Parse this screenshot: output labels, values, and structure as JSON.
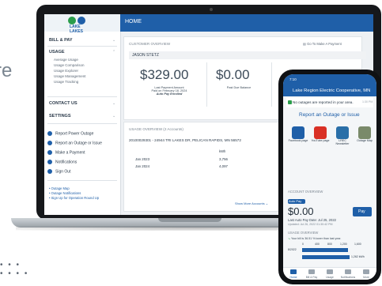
{
  "side_text": "re",
  "laptop": {
    "sidebar": {
      "logo_text": "LAKE LAKES",
      "sections": [
        {
          "label": "BILL & PAY"
        },
        {
          "label": "USAGE",
          "items": [
            "Average Usage",
            "Usage Comparison",
            "Usage Explorer",
            "Usage Management",
            "Usage Tracking"
          ]
        },
        {
          "label": "CONTACT US"
        },
        {
          "label": "SETTINGS"
        }
      ],
      "actions": [
        "Report Power Outage",
        "Report an Outage or Issue",
        "Make a Payment",
        "Notifications",
        "Sign Out"
      ],
      "links": [
        "Outage Map",
        "Outage Notifications",
        "Sign Up for Operation Round Up"
      ]
    },
    "header": {
      "title": "HOME"
    },
    "overview": {
      "title": "CUSTOMER OVERVIEW",
      "link": "Go To Make A Payment",
      "name": "JASON STETZ",
      "last_payment": {
        "amount": "$329.00",
        "label": "Last Payment Amount",
        "sub": "Paid on February 18, 2024",
        "note": "Auto Pay Enrolled"
      },
      "past_due": {
        "amount": "$0.00",
        "label": "Past Due Balance"
      },
      "current": {
        "amount": "Pa",
        "label": "Current M"
      }
    },
    "usage": {
      "title": "USAGE OVERVIEW (2 Accounts)",
      "account": "20100029301 - 24944 TRI LAKES DR, PELICAN RAPIDS, MN 56572",
      "col": "kWh",
      "rows": [
        {
          "period": "Jan 2023",
          "value": "3,756"
        },
        {
          "period": "Jan 2024",
          "value": "4,097"
        }
      ],
      "show_more": "Show More Accounts"
    }
  },
  "phone": {
    "time": "7:10",
    "title": "Lake Region Electric Cooperative, MN",
    "alert": "No outages are reported in your area.",
    "alert_time": "1:30 PM",
    "report": "Report an Outage or Issue",
    "tiles": [
      {
        "label": "Facebook page",
        "color": "#1f5fa8"
      },
      {
        "label": "YouTube page",
        "color": "#d93025"
      },
      {
        "label": "LREC Newsletter",
        "color": "#2a6fa8"
      },
      {
        "label": "Outage Map",
        "color": "#7a8a6a"
      }
    ],
    "account_overview": "ACCOUNT OVERVIEW",
    "pill": "Auto Pay",
    "amount": "$0.00",
    "pay": "Pay",
    "last_autopay": "Last Auto Pay Date: Jul 25, 2022",
    "updated": "Updated: Jul 26, 2022 01:30:42 PM",
    "usage_overview": "USAGE OVERVIEW",
    "trend": "Your bill is 36.51 % lower than last year.",
    "axis": [
      "0",
      "400",
      "800",
      "1,200",
      "1,600"
    ],
    "bars": [
      {
        "label": "8/2022",
        "value_text": ""
      },
      {
        "label": "",
        "value_text": "1,262 kWh"
      }
    ],
    "tabs": [
      "Home",
      "Bill & Pay",
      "Usage",
      "Notifications",
      "More"
    ]
  }
}
